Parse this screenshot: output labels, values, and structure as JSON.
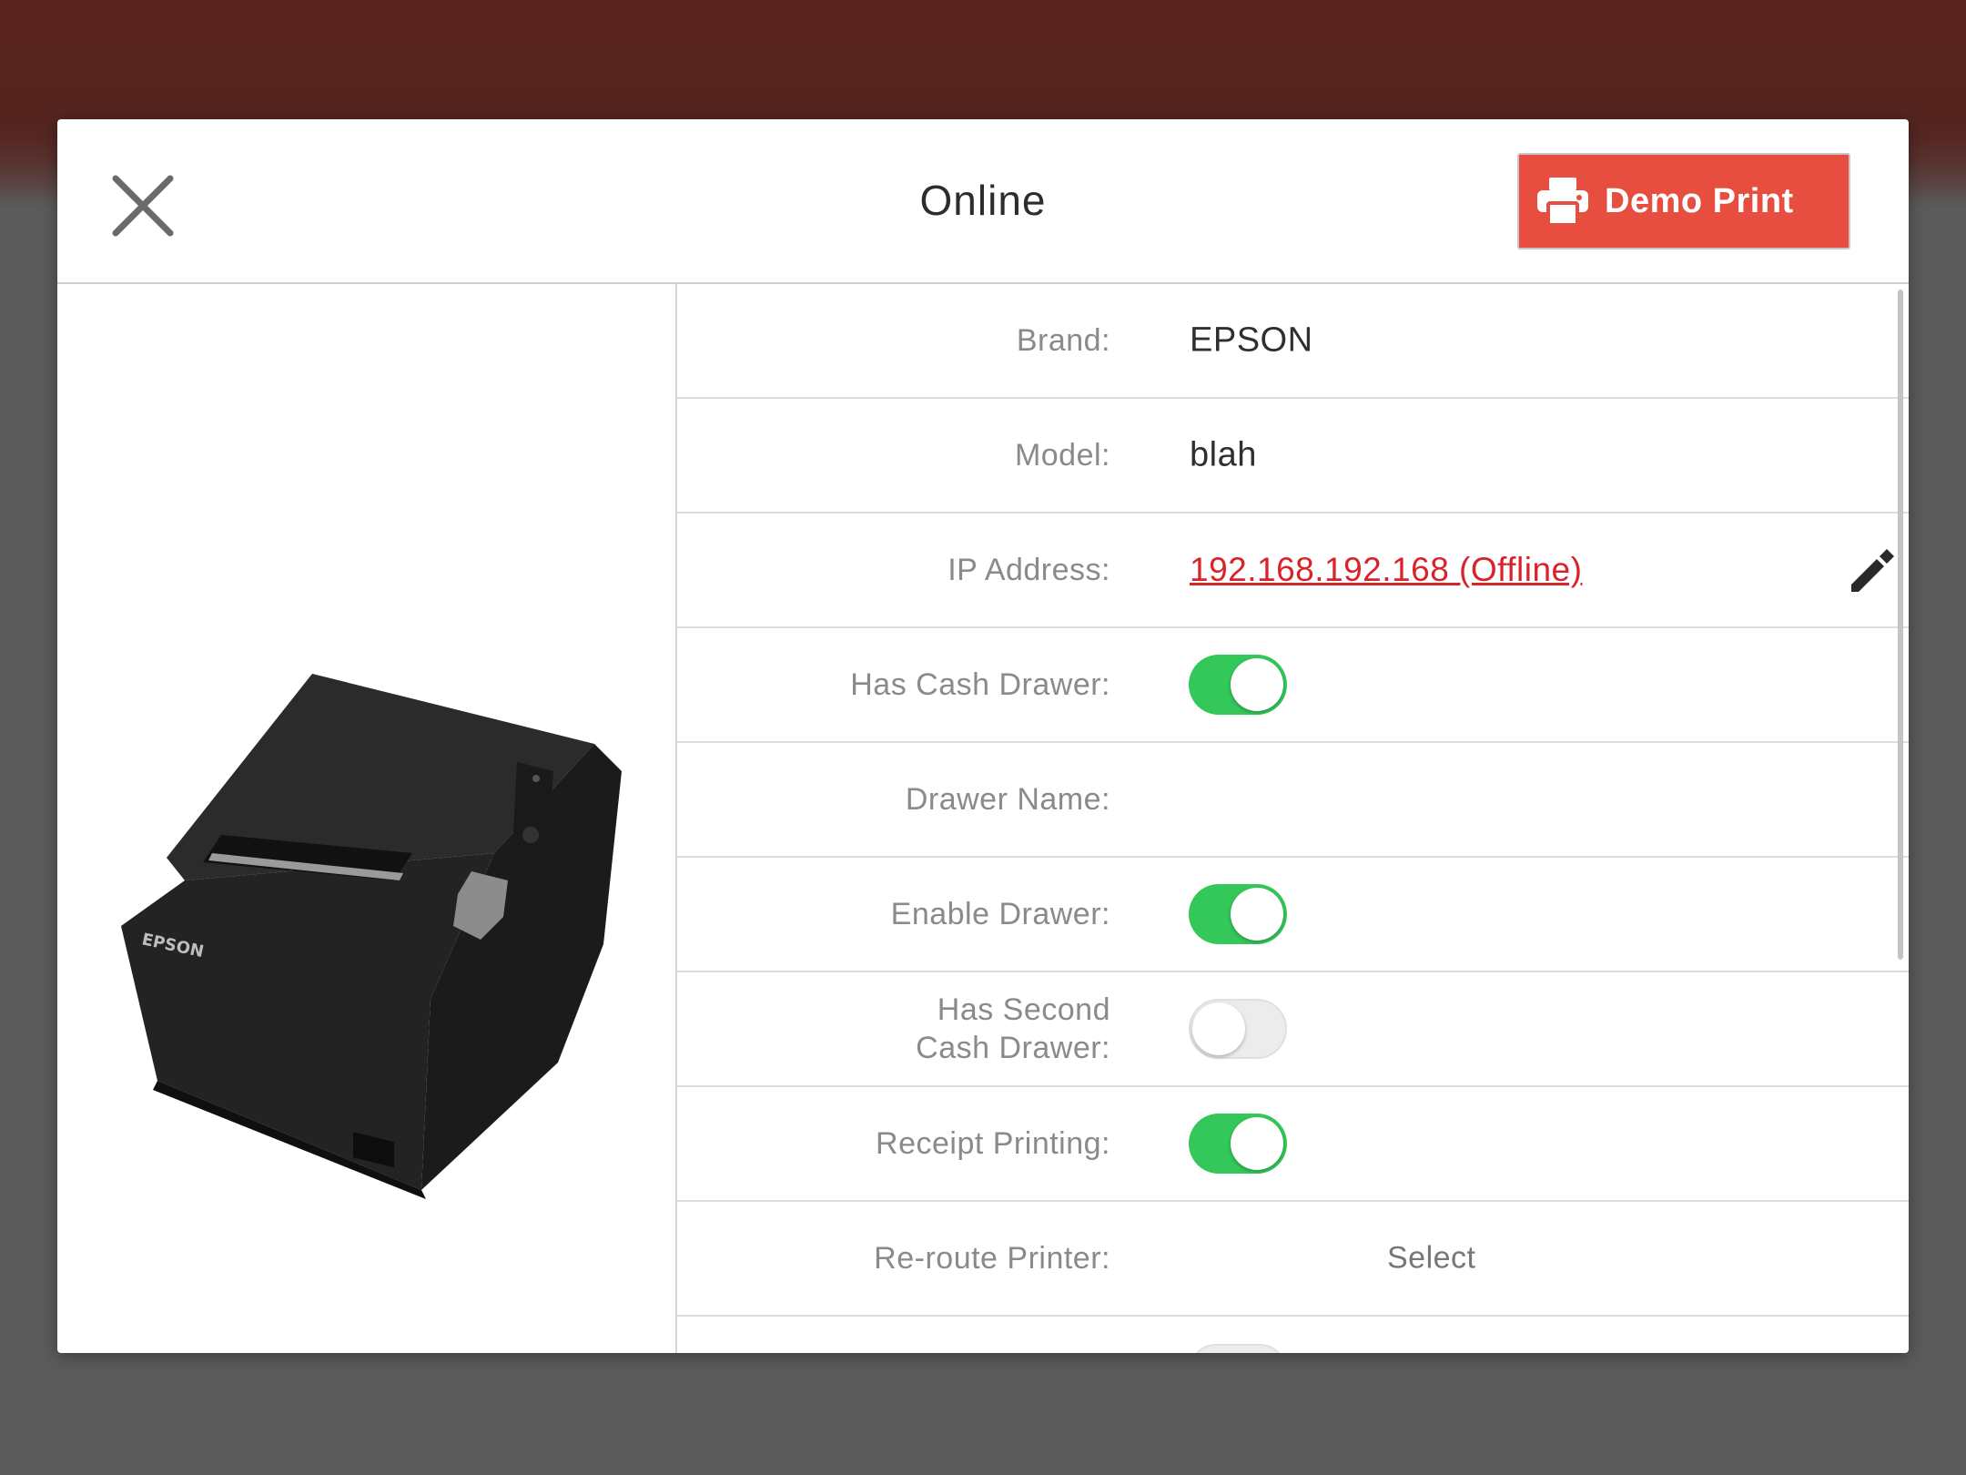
{
  "header": {
    "title": "Online",
    "demo_print_label": "Demo Print"
  },
  "printer_image": {
    "brand_text": "EPSON"
  },
  "details": {
    "brand": {
      "label": "Brand:",
      "value": "EPSON"
    },
    "model": {
      "label": "Model:",
      "value": "blah"
    },
    "ip_address": {
      "label": "IP Address:",
      "value": "192.168.192.168 (Offline)"
    },
    "has_cash_drawer": {
      "label": "Has Cash Drawer:",
      "on": true
    },
    "drawer_name": {
      "label": "Drawer Name:",
      "value": ""
    },
    "enable_drawer": {
      "label": "Enable Drawer:",
      "on": true
    },
    "has_second_cash_drawer": {
      "label_line1": "Has Second",
      "label_line2": "Cash Drawer:",
      "on": false
    },
    "receipt_printing": {
      "label": "Receipt Printing:",
      "on": true
    },
    "reroute_printer": {
      "label": "Re-route Printer:",
      "select_label": "Select"
    }
  },
  "colors": {
    "accent_red": "#e84e40",
    "toggle_on": "#34c759",
    "link_red": "#d9232a"
  }
}
